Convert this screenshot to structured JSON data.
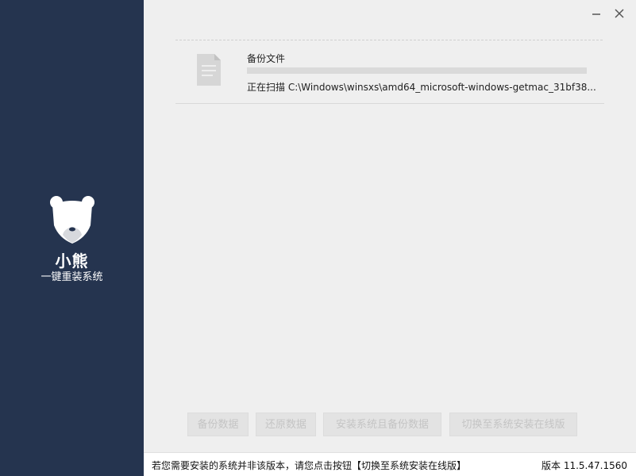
{
  "sidebar": {
    "brand_name": "小熊",
    "brand_subtitle": "一键重装系统"
  },
  "window_controls": {
    "minimize_icon": "minimize-icon",
    "close_icon": "close-icon"
  },
  "task": {
    "icon": "document-icon",
    "title": "备份文件",
    "progress": 0,
    "status": "正在扫描 C:\\Windows\\winsxs\\amd64_microsoft-windows-getmac_31bf38..."
  },
  "actions": {
    "backup_data": "备份数据",
    "restore_data": "还原数据",
    "install_and_backup": "安装系统且备份数据",
    "switch_online": "切换至系统安装在线版"
  },
  "footer": {
    "notice": "若您需要安装的系统并非该版本，请您点击按钮【切换至系统安装在线版】",
    "version": "版本 11.5.47.1560"
  },
  "colors": {
    "sidebar_bg": "#25344f",
    "main_bg": "#efefef",
    "disabled_button_bg": "#e3e3e3",
    "disabled_button_text": "#c4c4c4"
  }
}
